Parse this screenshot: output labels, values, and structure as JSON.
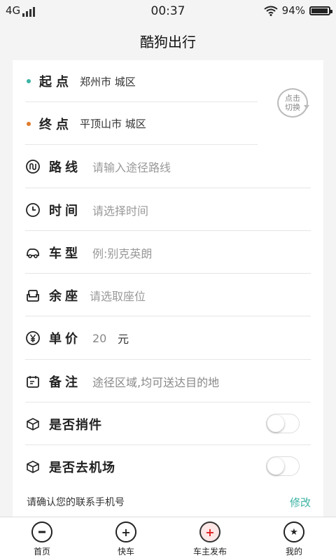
{
  "status_bar": {
    "network": "4G",
    "time": "00:37",
    "battery": "94%",
    "battery_level": 0.94
  },
  "title": "酷狗出行",
  "start": {
    "label": "起点",
    "value": "郑州市 城区",
    "dot_color": "#3bb3a3"
  },
  "end": {
    "label": "终点",
    "value": "平顶山市 城区",
    "dot_color": "#e07b2a"
  },
  "switch_button": {
    "line1": "点击",
    "line2": "切换"
  },
  "fields": {
    "route": {
      "label": "路线",
      "placeholder": "请输入途径路线"
    },
    "time": {
      "label": "时间",
      "placeholder": "请选择时间"
    },
    "car_type": {
      "label": "车型",
      "placeholder": "例:别克英朗"
    },
    "seats": {
      "label": "余座",
      "placeholder": "请选取座位"
    },
    "price": {
      "label": "单价",
      "value": "20",
      "unit": "元"
    },
    "note": {
      "label": "备注",
      "value": "途径区域,均可送达目的地"
    }
  },
  "toggles": {
    "parcel": {
      "label": "是否捎件",
      "on": false
    },
    "airport": {
      "label": "是否去机场",
      "on": false
    }
  },
  "phone_confirm": {
    "text": "请确认您的联系手机号",
    "action": "修改"
  },
  "tabs": [
    {
      "label": "首页",
      "icon": "home-icon"
    },
    {
      "label": "快车",
      "icon": "plus-circle-icon"
    },
    {
      "label": "车主发布",
      "icon": "plus-circle-red-icon"
    },
    {
      "label": "我的",
      "icon": "star-circle-icon"
    }
  ],
  "colors": {
    "accent": "#3cb3a3",
    "orange": "#e07b2a",
    "red": "#e02020"
  }
}
